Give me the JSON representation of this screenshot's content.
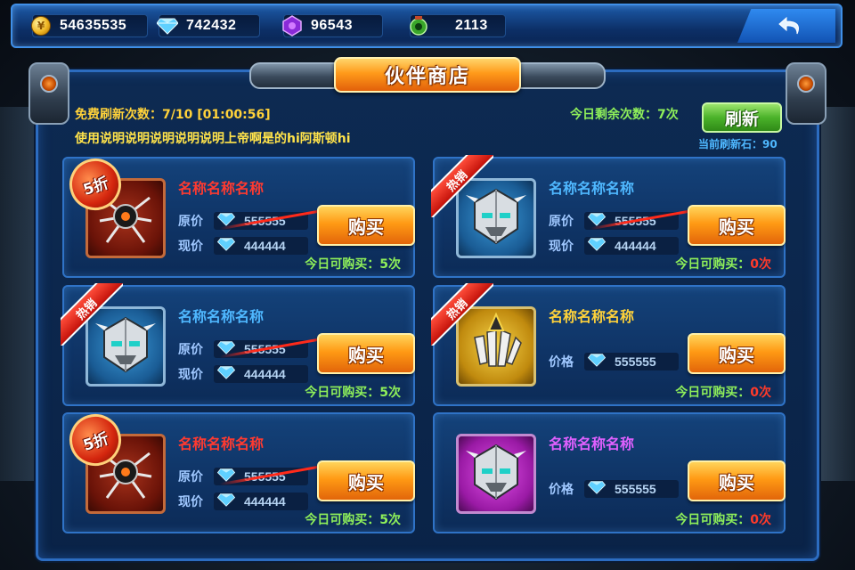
{
  "currencies": [
    {
      "icon": "gold-coin-icon",
      "value": "54635535"
    },
    {
      "icon": "diamond-icon",
      "value": "742432"
    },
    {
      "icon": "purple-gem-icon",
      "value": "96543"
    },
    {
      "icon": "green-token-icon",
      "value": "2113"
    }
  ],
  "title": "伙伴商店",
  "free_refresh_label": "免费刷新次数：7/10 [01:00:56]",
  "description": "使用说明说明说明说明说明上帝啊是的hi阿斯顿hi",
  "remaining_today_label": "今日剩余次数：7次",
  "refresh_button": "刷新",
  "refresh_cost_label": "当前刷新石：90",
  "colors": {
    "accent_orange": "#ff9a14",
    "green": "#8ff05a",
    "red": "#ff3a2a",
    "panel_border": "#2c6cc0"
  },
  "cards": [
    {
      "badge_type": "discount",
      "badge": "5折",
      "thumb": "red",
      "icon": "spider-mech-icon",
      "name": "名称名称名称",
      "name_color": "#ff3a30",
      "rows": [
        {
          "label": "原价",
          "value": "555555",
          "strike": true
        },
        {
          "label": "现价",
          "value": "444444",
          "strike": false
        }
      ],
      "buy": "购买",
      "limit_prefix": "今日可购买：",
      "limit_count": "5次",
      "limit_color": "green"
    },
    {
      "badge_type": "hot",
      "badge": "热销",
      "thumb": "blue",
      "icon": "robot-head-icon",
      "name": "名称名称名称",
      "name_color": "#4fb8ff",
      "rows": [
        {
          "label": "原价",
          "value": "555555",
          "strike": true
        },
        {
          "label": "现价",
          "value": "444444",
          "strike": false
        }
      ],
      "buy": "购买",
      "limit_prefix": "今日可购买：",
      "limit_count": "0次",
      "limit_color": "red"
    },
    {
      "badge_type": "hot",
      "badge": "热销",
      "thumb": "blue",
      "icon": "robot-head-icon",
      "name": "名称名称名称",
      "name_color": "#4fb8ff",
      "rows": [
        {
          "label": "原价",
          "value": "555555",
          "strike": true
        },
        {
          "label": "现价",
          "value": "444444",
          "strike": false
        }
      ],
      "buy": "购买",
      "limit_prefix": "今日可购买：",
      "limit_count": "5次",
      "limit_color": "green"
    },
    {
      "badge_type": "hot",
      "badge": "热销",
      "thumb": "gold",
      "icon": "gold-claw-icon",
      "name": "名称名称名称",
      "name_color": "#ffd23a",
      "rows": [
        {
          "label": "价格",
          "value": "555555",
          "strike": false
        }
      ],
      "buy": "购买",
      "limit_prefix": "今日可购买：",
      "limit_count": "0次",
      "limit_color": "red"
    },
    {
      "badge_type": "discount",
      "badge": "5折",
      "thumb": "red",
      "icon": "spider-mech-icon",
      "name": "名称名称名称",
      "name_color": "#ff3a30",
      "rows": [
        {
          "label": "原价",
          "value": "555555",
          "strike": true
        },
        {
          "label": "现价",
          "value": "444444",
          "strike": false
        }
      ],
      "buy": "购买",
      "limit_prefix": "今日可购买：",
      "limit_count": "5次",
      "limit_color": "green"
    },
    {
      "badge_type": "none",
      "badge": "",
      "thumb": "purple",
      "icon": "robot-head-icon",
      "name": "名称名称名称",
      "name_color": "#e060ff",
      "rows": [
        {
          "label": "价格",
          "value": "555555",
          "strike": false
        }
      ],
      "buy": "购买",
      "limit_prefix": "今日可购买：",
      "limit_count": "0次",
      "limit_color": "red"
    }
  ]
}
